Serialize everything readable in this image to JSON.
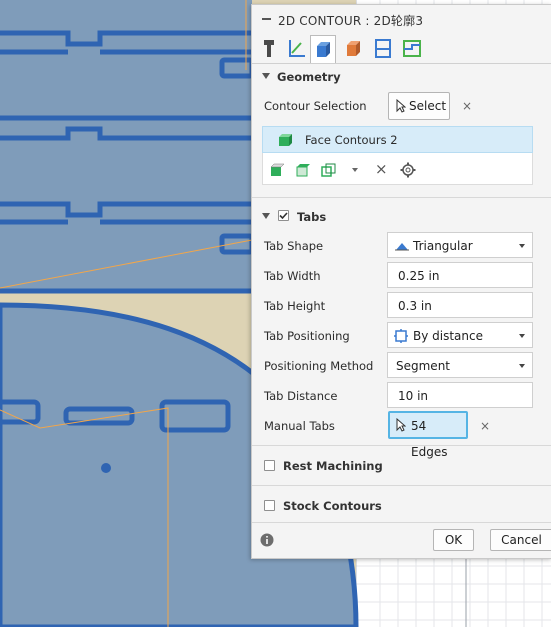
{
  "dialog": {
    "title": "2D CONTOUR : 2D轮廓3",
    "tabs": [
      {
        "icon": "tool-icon"
      },
      {
        "icon": "axes-icon"
      },
      {
        "icon": "geometry-cube-icon"
      },
      {
        "icon": "stock-cube-icon"
      },
      {
        "icon": "heights-icon"
      },
      {
        "icon": "passes-icon"
      }
    ]
  },
  "geometry": {
    "header": "Geometry",
    "contour_selection_label": "Contour Selection",
    "select_button": "Select",
    "selected_item": "Face Contours 2"
  },
  "tabs_section": {
    "header": "Tabs",
    "checked": true,
    "tab_shape": {
      "label": "Tab Shape",
      "value": "Triangular"
    },
    "tab_width": {
      "label": "Tab Width",
      "value": "0.25 in"
    },
    "tab_height": {
      "label": "Tab Height",
      "value": "0.3 in"
    },
    "tab_positioning": {
      "label": "Tab Positioning",
      "value": "By distance"
    },
    "positioning_method": {
      "label": "Positioning Method",
      "value": "Segment"
    },
    "tab_distance": {
      "label": "Tab Distance",
      "value": "10 in"
    },
    "manual_tabs": {
      "label": "Manual Tabs",
      "value": "54 Edges"
    }
  },
  "rest_machining": {
    "label": "Rest Machining",
    "checked": false
  },
  "stock_contours": {
    "label": "Stock Contours",
    "checked": false
  },
  "footer": {
    "ok": "OK",
    "cancel": "Cancel"
  },
  "colors": {
    "part_fill": "#7f9cba",
    "part_outline": "#2f64b2",
    "stock": "#ddd3b4",
    "toolpath": "#f2a64a",
    "selection_highlight": "#d7ecf9",
    "selection_border": "#55b4e4"
  }
}
